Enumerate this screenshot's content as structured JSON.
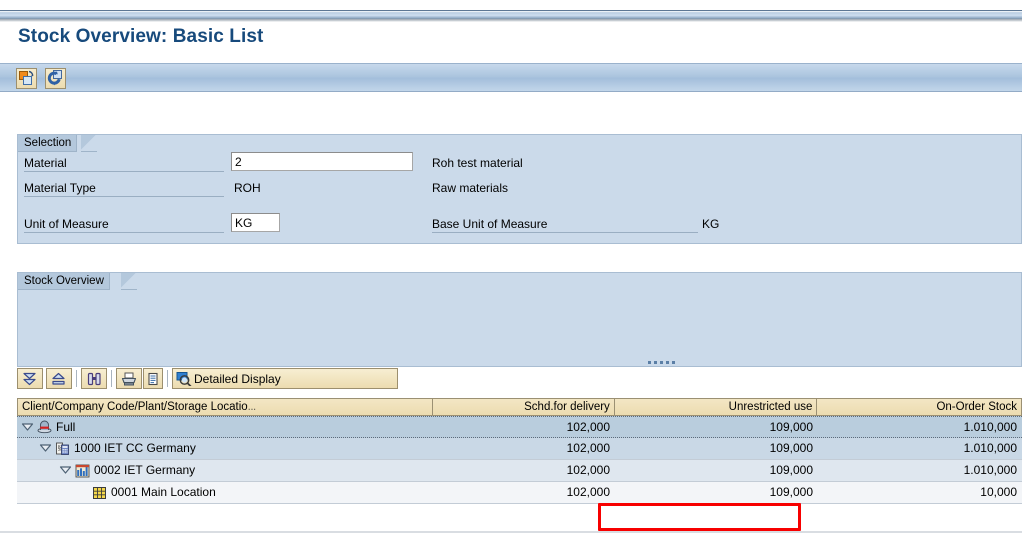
{
  "page_title": "Stock Overview: Basic List",
  "accent_color": "#174a7c",
  "highlight_color": "#f70000",
  "app_toolbar": {
    "buttons": [
      {
        "name": "change-view-button",
        "icon": "change-view-icon",
        "tooltip": "Change View"
      },
      {
        "name": "refresh-button",
        "icon": "refresh-icon",
        "tooltip": "Refresh"
      }
    ]
  },
  "selection_panel": {
    "tab_label": "Selection",
    "fields": [
      {
        "label": "Material",
        "value": "2",
        "input": true,
        "description": "Roh test material"
      },
      {
        "label": "Material Type",
        "value": "ROH",
        "input": false,
        "description": "Raw materials"
      },
      {
        "label": "Unit of Measure",
        "value": "KG",
        "input": true,
        "description": "Base Unit of Measure",
        "description_value": "KG"
      }
    ]
  },
  "stock_panel": {
    "tab_label": "Stock Overview",
    "list_toolbar": {
      "expand_all_label": "Expand All",
      "collapse_all_label": "Collapse All",
      "find_label": "Find",
      "print_label": "Print",
      "print_preview_label": "Print Preview",
      "detailed_display_label": "Detailed Display"
    },
    "table": {
      "columns": [
        {
          "key": "node",
          "label": "Client/Company Code/Plant/Storage Locatio",
          "truncated": true,
          "align": "left"
        },
        {
          "key": "schd",
          "label": "Schd.for delivery",
          "align": "right"
        },
        {
          "key": "unrestricted",
          "label": "Unrestricted use",
          "align": "right"
        },
        {
          "key": "onorder",
          "label": "On-Order Stock",
          "align": "right"
        }
      ],
      "rows": [
        {
          "level": 0,
          "expanded": true,
          "icon": "client-hat-icon",
          "label": "Full",
          "schd": "102,000",
          "unrestricted": "109,000",
          "onorder": "1.010,000"
        },
        {
          "level": 1,
          "expanded": true,
          "icon": "company-code-icon",
          "label": "1000 IET CC Germany",
          "schd": "102,000",
          "unrestricted": "109,000",
          "onorder": "1.010,000"
        },
        {
          "level": 2,
          "expanded": true,
          "icon": "plant-icon",
          "label": "0002 IET Germany",
          "schd": "102,000",
          "unrestricted": "109,000",
          "onorder": "1.010,000"
        },
        {
          "level": 3,
          "expanded": false,
          "icon": "storage-location-icon",
          "label": "0001 Main Location",
          "schd": "102,000",
          "unrestricted": "109,000",
          "onorder": "10,000"
        }
      ],
      "highlighted_cell": {
        "row_index": 3,
        "column_key": "unrestricted",
        "value": "109,000"
      }
    }
  }
}
